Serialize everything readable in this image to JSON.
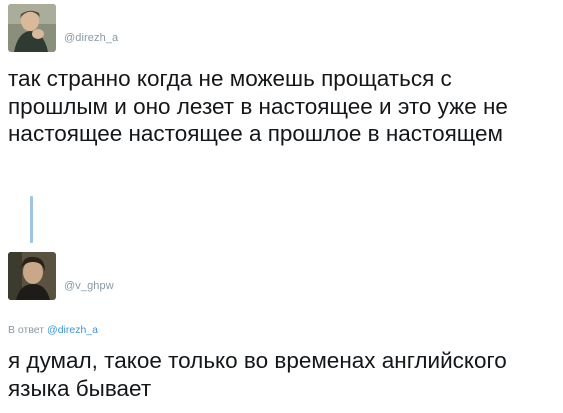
{
  "tweets": [
    {
      "handle": "@direzh_a",
      "text": "так странно когда не можешь прощаться с прошлым и оно лезет в настоящее и это уже не настоящее настоящее а прошлое в настоящем"
    },
    {
      "handle": "@v_ghpw",
      "reply_prefix": "В ответ",
      "reply_to": "@direzh_a",
      "text": "я думал, такое только во временах английского языка бывает"
    }
  ],
  "colors": {
    "text": "#14171a",
    "secondary": "#8899a6",
    "link": "#3b94d9",
    "thread_line": "#9cc6e4"
  }
}
